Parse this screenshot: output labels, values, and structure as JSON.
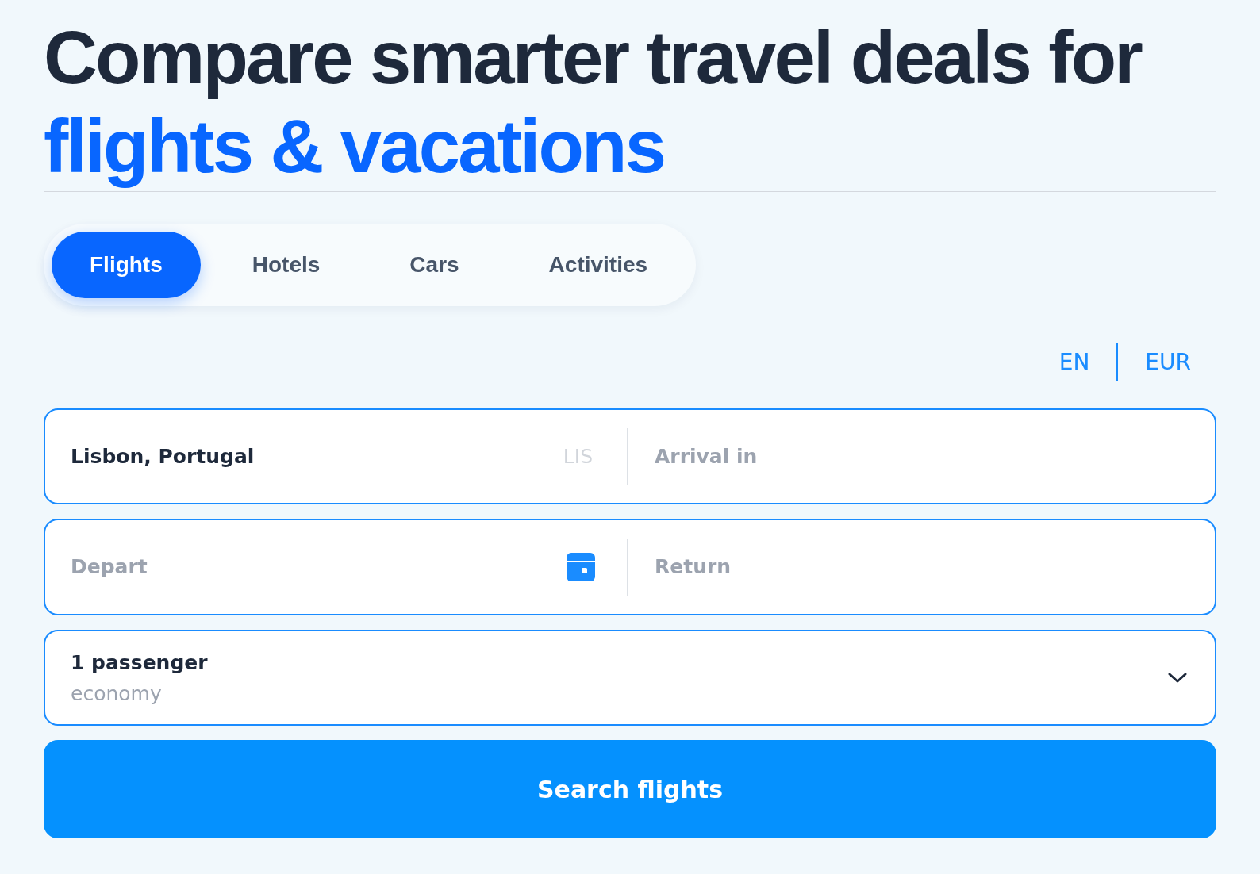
{
  "heading": {
    "text": "Compare smarter travel deals for",
    "highlight": "flights & vacations"
  },
  "tabs": [
    {
      "label": "Flights",
      "selected": true
    },
    {
      "label": "Hotels",
      "selected": false
    },
    {
      "label": "Cars",
      "selected": false
    },
    {
      "label": "Activities",
      "selected": false
    }
  ],
  "locale": {
    "language": "EN",
    "currency": "EUR"
  },
  "route": {
    "origin": {
      "value": "Lisbon, Portugal",
      "code": "LIS"
    },
    "destination": {
      "placeholder": "Arrival in"
    }
  },
  "dates": {
    "depart": {
      "placeholder": "Depart"
    },
    "return": {
      "placeholder": "Return"
    }
  },
  "travellers": {
    "passengers": "1 passenger",
    "cabin_class": "economy"
  },
  "search_button": "Search flights"
}
